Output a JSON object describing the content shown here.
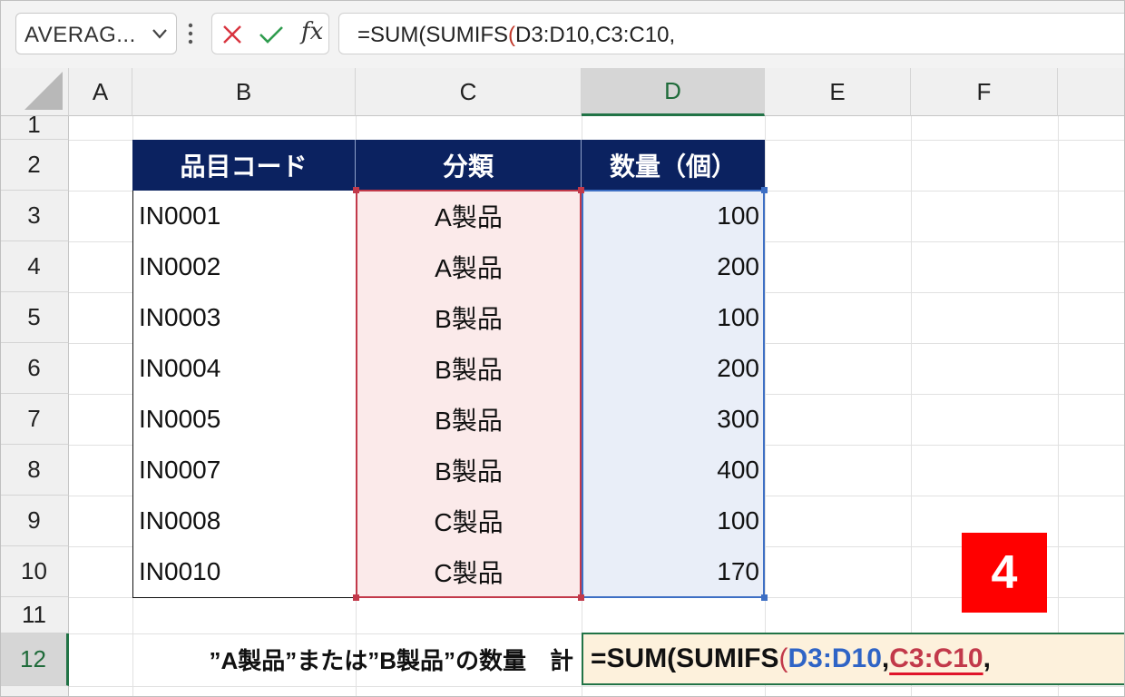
{
  "formula_bar": {
    "name_box": "AVERAG...",
    "fx_label": "fx",
    "formula_prefix": "=SUM",
    "formula_paren": "(",
    "formula_mid": "SUMIFS",
    "formula_paren2": "(",
    "formula_rest": "D3:D10,C3:C10,"
  },
  "columns": [
    "A",
    "B",
    "C",
    "D",
    "E",
    "F"
  ],
  "selected_column": "D",
  "rows": [
    "1",
    "2",
    "3",
    "4",
    "5",
    "6",
    "7",
    "8",
    "9",
    "10",
    "11",
    "12"
  ],
  "selected_row": "12",
  "table": {
    "headers": [
      "品目コード",
      "分類",
      "数量（個）"
    ],
    "records": [
      {
        "code": "IN0001",
        "category": "A製品",
        "qty": "100"
      },
      {
        "code": "IN0002",
        "category": "A製品",
        "qty": "200"
      },
      {
        "code": "IN0003",
        "category": "B製品",
        "qty": "100"
      },
      {
        "code": "IN0004",
        "category": "B製品",
        "qty": "200"
      },
      {
        "code": "IN0005",
        "category": "B製品",
        "qty": "300"
      },
      {
        "code": "IN0007",
        "category": "B製品",
        "qty": "400"
      },
      {
        "code": "IN0008",
        "category": "C製品",
        "qty": "100"
      },
      {
        "code": "IN0010",
        "category": "C製品",
        "qty": "170"
      }
    ]
  },
  "summary_label": "”A製品”または”B製品”の数量　計",
  "edit_cell": {
    "part1": "=SUM(SUMIFS",
    "paren": "(",
    "ref1": "D3:D10",
    "comma1": ",",
    "ref2": "C3:C10",
    "comma2": ","
  },
  "step_badge": "4",
  "colors": {
    "header_fill": "#0b2260",
    "criteria_range": "#c2394a",
    "sum_range": "#3d6fc4",
    "badge": "#ff0000",
    "excel_green": "#217346"
  }
}
